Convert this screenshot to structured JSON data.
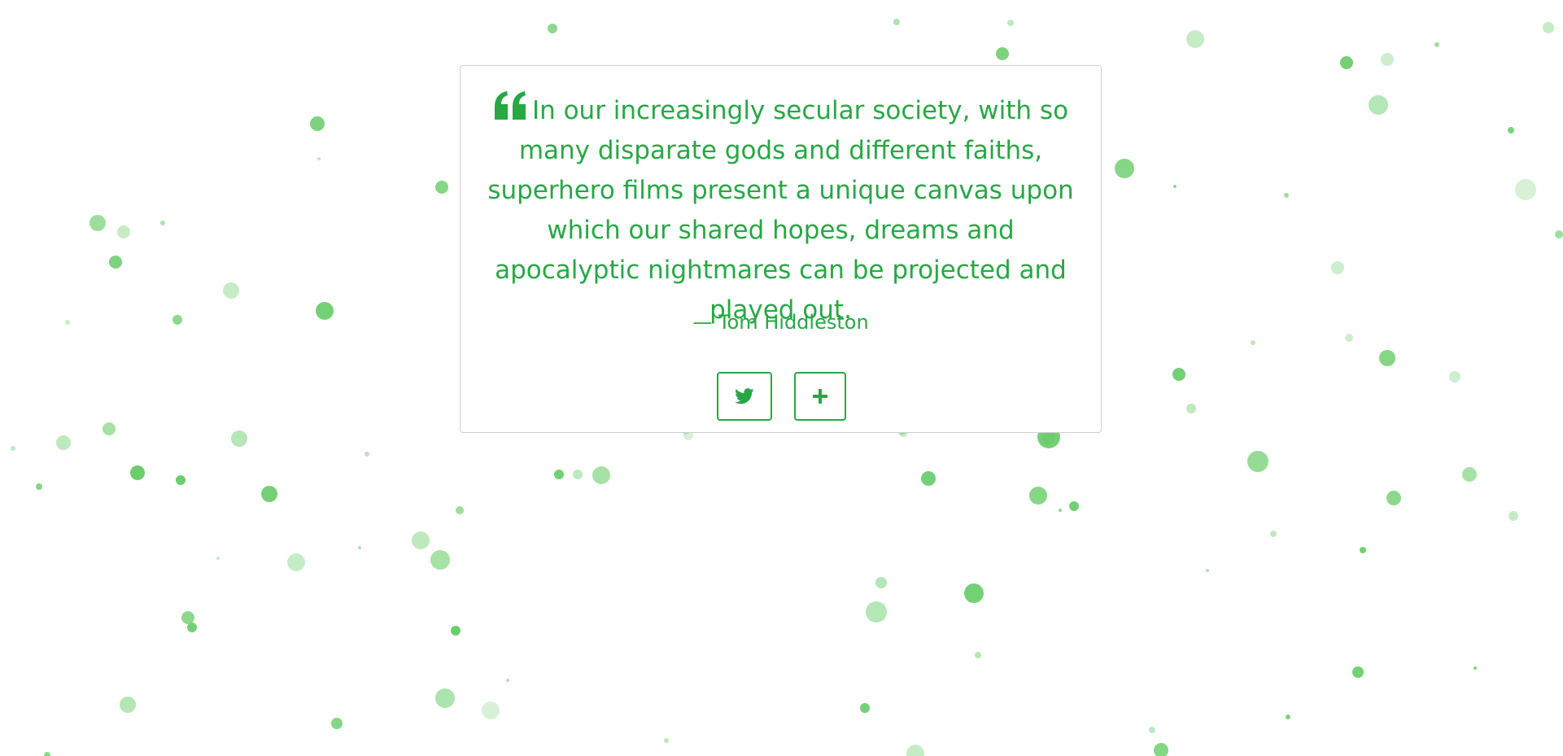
{
  "quote": {
    "text": "In our increasingly secular society, with so many disparate gods and different faiths, superhero films present a unique canvas upon which our shared hopes, dreams and apocalyptic nightmares can be projected and played out.",
    "author": "— Tom Hiddleston",
    "open_icon": "quote-left-icon"
  },
  "buttons": {
    "tweet": {
      "icon": "twitter-icon"
    },
    "new_quote": {
      "icon": "plus-icon"
    }
  },
  "colors": {
    "accent": "#28a745",
    "particle": "#5cc85c",
    "border": "#cfcfcf",
    "background": "#ffffff"
  }
}
